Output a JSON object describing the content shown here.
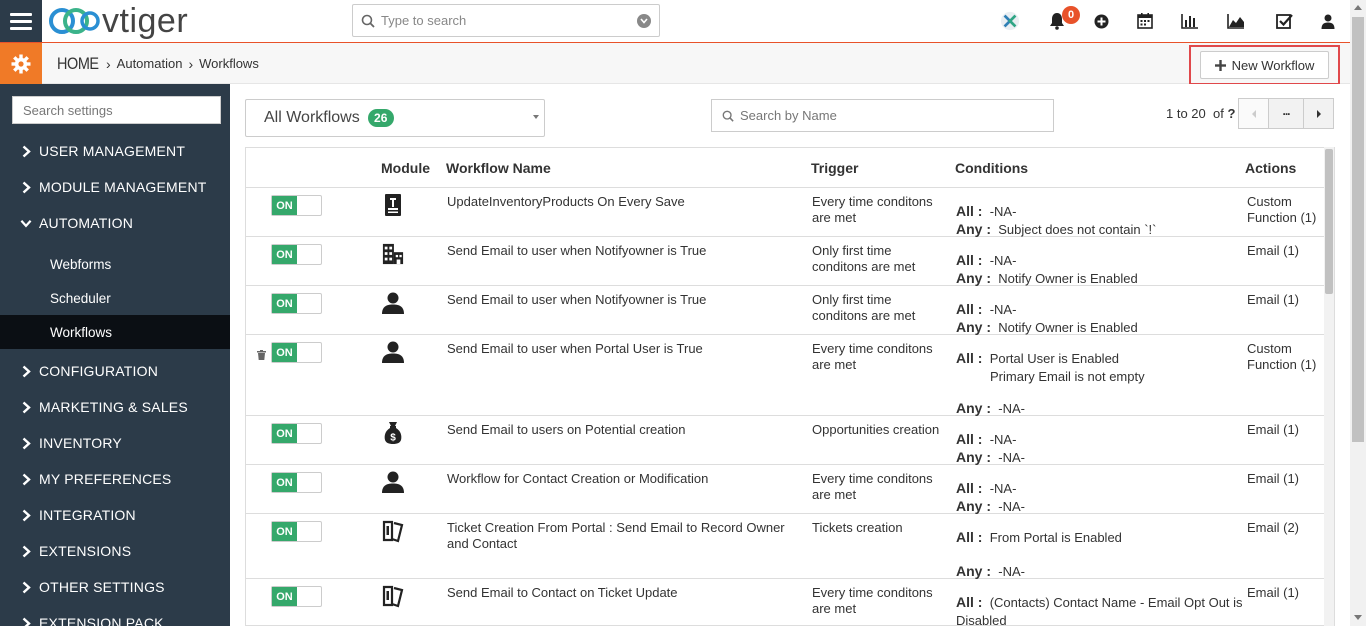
{
  "app": {
    "name": "vtiger",
    "search_placeholder": "Type to search",
    "notification_count": "0",
    "accent_color": "#e8522a",
    "sidebar_color": "#2c3b49",
    "toggle_color": "#35a86b"
  },
  "breadcrumb": {
    "home": "HOME",
    "automation": "Automation",
    "workflows": "Workflows"
  },
  "toolbar": {
    "new_workflow_label": "New Workflow"
  },
  "sidebar": {
    "search_placeholder": "Search settings",
    "sections": [
      {
        "label": "USER MANAGEMENT",
        "expanded": false
      },
      {
        "label": "MODULE MANAGEMENT",
        "expanded": false
      },
      {
        "label": "AUTOMATION",
        "expanded": true
      },
      {
        "label": "CONFIGURATION",
        "expanded": false
      },
      {
        "label": "MARKETING & SALES",
        "expanded": false
      },
      {
        "label": "INVENTORY",
        "expanded": false
      },
      {
        "label": "MY PREFERENCES",
        "expanded": false
      },
      {
        "label": "INTEGRATION",
        "expanded": false
      },
      {
        "label": "EXTENSIONS",
        "expanded": false
      },
      {
        "label": "OTHER SETTINGS",
        "expanded": false
      },
      {
        "label": "EXTENSION PACK",
        "expanded": false
      }
    ],
    "automation_items": [
      {
        "label": "Webforms",
        "active": false
      },
      {
        "label": "Scheduler",
        "active": false
      },
      {
        "label": "Workflows",
        "active": true
      }
    ]
  },
  "list": {
    "filter_label": "All Workflows",
    "filter_count": "26",
    "name_search_placeholder": "Search by Name",
    "pager_range": "1 to 20",
    "pager_of": "of",
    "pager_total": "?",
    "more_label": "...",
    "columns": [
      "Module",
      "Workflow Name",
      "Trigger",
      "Conditions",
      "Actions"
    ],
    "toggle_label": "ON",
    "all_label": "All :",
    "any_label": "Any :",
    "rows": [
      {
        "module_icon": "invoice-icon",
        "name": "UpdateInventoryProducts On Every Save",
        "trigger": "Every time conditons are met",
        "all": [
          "-NA-"
        ],
        "any": [
          "Subject does not contain `!`"
        ],
        "action": "Custom Function (1)",
        "has_trash": false
      },
      {
        "module_icon": "organization-icon",
        "name": "Send Email to user when Notifyowner is True",
        "trigger": "Only first time conditons are met",
        "all": [
          "-NA-"
        ],
        "any": [
          "Notify Owner is Enabled"
        ],
        "action": "Email (1)",
        "has_trash": false
      },
      {
        "module_icon": "contact-icon",
        "name": "Send Email to user when Notifyowner is True",
        "trigger": "Only first time conditons are met",
        "all": [
          "-NA-"
        ],
        "any": [
          "Notify Owner is Enabled"
        ],
        "action": "Email (1)",
        "has_trash": false
      },
      {
        "module_icon": "contact-icon",
        "name": "Send Email to user when Portal User is True",
        "trigger": "Every time conditons are met",
        "all": [
          "Portal User is Enabled",
          "Primary Email is not empty"
        ],
        "any": [
          "-NA-"
        ],
        "action": "Custom Function (1)",
        "has_trash": true
      },
      {
        "module_icon": "money-bag-icon",
        "name": "Send Email to users on Potential creation",
        "trigger": "Opportunities creation",
        "all": [
          "-NA-"
        ],
        "any": [
          "-NA-"
        ],
        "action": "Email (1)",
        "has_trash": false
      },
      {
        "module_icon": "contact-icon",
        "name": "Workflow for Contact Creation or Modification",
        "trigger": "Every time conditons are met",
        "all": [
          "-NA-"
        ],
        "any": [
          "-NA-"
        ],
        "action": "Email (1)",
        "has_trash": false
      },
      {
        "module_icon": "ticket-icon",
        "name": "Ticket Creation From Portal : Send Email to Record Owner and Contact",
        "trigger": "Tickets creation",
        "all": [
          "From Portal is Enabled"
        ],
        "any": [
          "-NA-"
        ],
        "action": "Email (2)",
        "has_trash": false
      },
      {
        "module_icon": "ticket-icon",
        "name": "Send Email to Contact on Ticket Update",
        "trigger": "Every time conditons are met",
        "all": [
          "(Contacts) Contact Name - Email Opt Out is Disabled"
        ],
        "any": [],
        "action": "Email (1)",
        "has_trash": false
      }
    ]
  }
}
